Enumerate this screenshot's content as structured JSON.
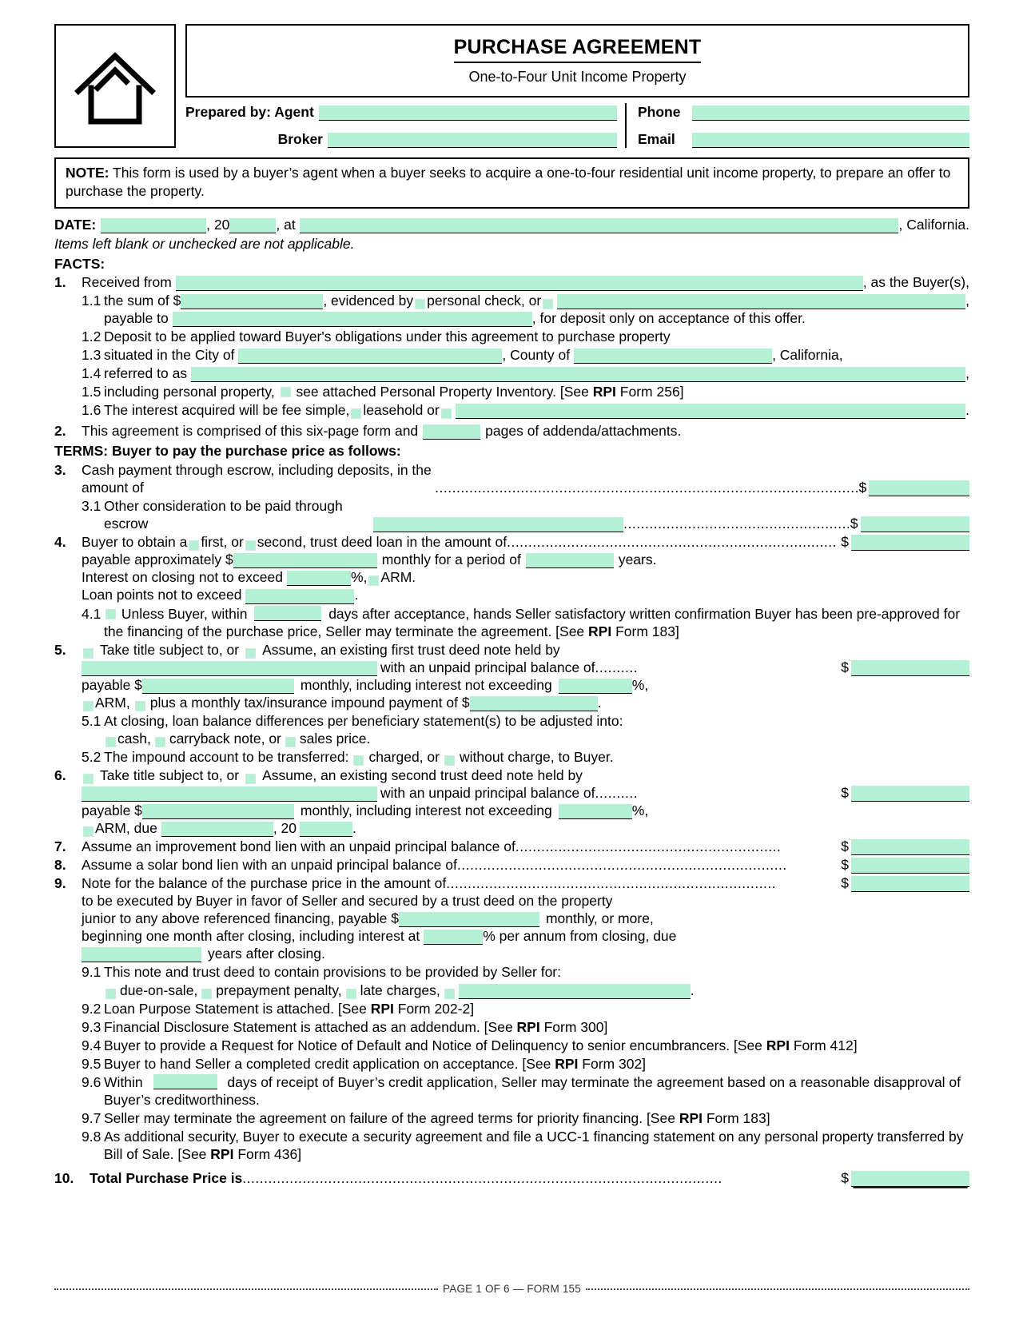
{
  "header": {
    "logo_icon": "house-icon",
    "title": "PURCHASE AGREEMENT",
    "subtitle": "One-to-Four Unit Income Property",
    "prepared_by_label": "Prepared by: Agent",
    "broker_label": "Broker",
    "phone_label": "Phone",
    "email_label": "Email",
    "agent_value": "",
    "broker_value": "",
    "phone_value": "",
    "email_value": ""
  },
  "note": {
    "label": "NOTE:",
    "text": " This form is used by a buyer’s agent when a buyer seeks to acquire a one-to-four residential unit income property, to prepare an offer to purchase the property."
  },
  "date_row": {
    "label": "DATE:",
    "day_value": "",
    "year_prefix": ", 20",
    "year_value": "",
    "at_label": ", at",
    "place_value": "",
    "state": ", California."
  },
  "italic_note": "Items left blank or unchecked are not applicable.",
  "facts_header": "FACTS:",
  "terms_header": "TERMS: Buyer to pay the purchase price as follows:",
  "items": {
    "i1": {
      "num": "1.",
      "lead": "Received from",
      "tail": ", as the Buyer(s),",
      "s11": {
        "num": "1.1",
        "t1": "the sum of $",
        "t2": ", evidenced by",
        "cb1": "personal-check-checkbox",
        "t3": "personal check, or",
        "cb2": "other-evidence-checkbox",
        "t4": "payable to",
        "t5": ", for deposit only on acceptance of this offer."
      },
      "s12": {
        "num": "1.2",
        "text": "Deposit to be applied toward Buyer's obligations under this agreement to purchase property"
      },
      "s13": {
        "num": "1.3",
        "t1": "situated in the City of",
        "t2": ", County of",
        "t3": ", California,"
      },
      "s14": {
        "num": "1.4",
        "t1": "referred to as",
        "t2": ","
      },
      "s15": {
        "num": "1.5",
        "t1": "including personal property,",
        "cb": "personal-property-inventory-checkbox",
        "t2": "see attached Personal Property Inventory. [See ",
        "rpi": "RPI",
        "t3": " Form 256]"
      },
      "s16": {
        "num": "1.6",
        "t1": "The interest acquired will be fee simple,",
        "cb1": "leasehold-checkbox",
        "t2": "leasehold or",
        "cb2": "other-interest-checkbox",
        "t3": "."
      }
    },
    "i2": {
      "num": "2.",
      "t1": "This agreement is comprised of this six-page form and",
      "t2": "pages of addenda/attachments."
    },
    "i3": {
      "num": "3.",
      "text": "Cash payment through escrow, including deposits, in the amount of",
      "amount": "",
      "s31": {
        "num": "3.1",
        "text": "Other consideration to be paid through escrow",
        "amount": ""
      }
    },
    "i4": {
      "num": "4.",
      "t1": "Buyer to obtain a",
      "cb1": "first-trust-deed-checkbox",
      "t2": "first, or",
      "cb2": "second-trust-deed-checkbox",
      "t3": "second, trust deed loan in the amount of",
      "amount": "",
      "l2a": "payable  approximately  $",
      "l2b": "monthly  for  a  period  of",
      "l2c": "years.",
      "l3a": "Interest on closing not to exceed",
      "l3b": "%,",
      "cb3": "arm-checkbox",
      "l3c": "ARM.",
      "l4a": "Loan points not to exceed",
      "l4b": ".",
      "s41": {
        "num": "4.1",
        "cb": "pre-approval-termination-checkbox",
        "t1": "Unless Buyer, within",
        "t2": "days after acceptance, hands Seller satisfactory written confirmation Buyer has been pre-approved for the financing of the    purchase    price, Seller may terminate the agreement. [See ",
        "rpi": "RPI",
        "t3": " Form 183]"
      }
    },
    "i5": {
      "num": "5.",
      "cb1": "take-title-subject-to-checkbox",
      "t1": "Take  title  subject  to,  or",
      "cb2": "assume-checkbox",
      "t2": "Assume,  an  existing  first  trust  deed  note  held  by",
      "t3": "with an unpaid principal balance of",
      "amount": "",
      "l3a": "payable  $",
      "l3b": "monthly,  including  interest  not  exceeding",
      "l3c": "%,",
      "cb3": "arm-checkbox",
      "l4a": "ARM,",
      "cb4": "impound-payment-checkbox",
      "l4b": "plus a monthly tax/insurance impound payment of $",
      "l4c": ".",
      "s51": {
        "num": "5.1",
        "t1": "At closing, loan balance differences per beneficiary statement(s) to be adjusted into:",
        "cb1": "cash-checkbox",
        "t2": "cash,",
        "cb2": "carryback-note-checkbox",
        "t3": "carryback note, or",
        "cb3": "sales-price-checkbox",
        "t4": "sales price."
      },
      "s52": {
        "num": "5.2",
        "t1": "The  impound  account  to  be  transferred:",
        "cb1": "charged-checkbox",
        "t2": "charged,  or",
        "cb2": "without-charge-checkbox",
        "t3": "without  charge,  to  Buyer."
      }
    },
    "i6": {
      "num": "6.",
      "cb1": "take-title-subject-to-checkbox",
      "t1": "Take  title  subject  to,  or",
      "cb2": "assume-checkbox",
      "t2": "Assume,  an  existing  second  trust  deed  note  held  by",
      "t3": "with an unpaid principal balance of",
      "amount": "",
      "l3a": "payable  $",
      "l3b": "monthly,  including  interest  not  exceeding",
      "l3c": "%,",
      "cb3": "arm-checkbox",
      "l4a": "ARM, due",
      "l4b": ", 20",
      "l4c": "."
    },
    "i7": {
      "num": "7.",
      "text": "Assume an improvement bond lien with an unpaid principal balance of",
      "amount": ""
    },
    "i8": {
      "num": "8.",
      "text": "Assume a solar bond lien with an unpaid principal balance of",
      "amount": ""
    },
    "i9": {
      "num": "9.",
      "text": "Note for the balance of the purchase price in the amount of",
      "amount": "",
      "l2": "to  be  executed  by  Buyer  in  favor  of  Seller  and  secured  by  a  trust  deed  on  the  property",
      "l3a": "junior  to  any  above  referenced  financing,  payable  $",
      "l3b": "monthly,  or  more,",
      "l4a": "beginning one month after closing, including interest at",
      "l4b": "% per annum from closing, due",
      "l5b": "years after closing.",
      "s91": {
        "num": "9.1",
        "t1": "This  note  and  trust  deed  to  contain  provisions  to  be  provided  by  Seller  for:",
        "cb1": "due-on-sale-checkbox",
        "t2": "due-on-sale,",
        "cb2": "prepayment-penalty-checkbox",
        "t3": "prepayment penalty,",
        "cb3": "late-charges-checkbox",
        "t4": "late charges,",
        "cb4": "other-provision-checkbox",
        "t5": "."
      },
      "s92": {
        "num": "9.2",
        "t1": "Loan Purpose Statement is attached. [See ",
        "rpi": "RPI",
        "t2": " Form 202-2]"
      },
      "s93": {
        "num": "9.3",
        "t1": "Financial Disclosure Statement is attached as an addendum. [See ",
        "rpi": "RPI",
        "t2": " Form 300]"
      },
      "s94": {
        "num": "9.4",
        "t1": "Buyer to provide a Request for Notice of Default and Notice of Delinquency to senior encumbrancers. [See ",
        "rpi": "RPI",
        "t2": " Form 412]"
      },
      "s95": {
        "num": "9.5",
        "t1": "Buyer to hand Seller a completed credit application on acceptance. [See ",
        "rpi": "RPI",
        "t2": " Form 302]"
      },
      "s96": {
        "num": "9.6",
        "t1": "Within",
        "t2": "days of receipt of Buyer’s credit application, Seller may terminate the agreement based on a reasonable disapproval of Buyer’s creditworthiness."
      },
      "s97": {
        "num": "9.7",
        "t1": "Seller may terminate the agreement on failure of the agreed terms for priority financing. [See ",
        "rpi": "RPI",
        "t2": " Form 183]"
      },
      "s98": {
        "num": "9.8",
        "t1": "As additional security, Buyer to execute a security agreement and file a UCC-1 financing statement on any personal property transferred by Bill of Sale. [See ",
        "rpi": "RPI",
        "t2": " Form 436]"
      }
    },
    "i10": {
      "num": "10.",
      "text": "Total Purchase Price is",
      "amount": ""
    }
  },
  "footer": {
    "text": "PAGE 1 OF 6 — FORM 155"
  },
  "colors": {
    "field_fill": "#b4f0d4",
    "ink": "#000000"
  }
}
